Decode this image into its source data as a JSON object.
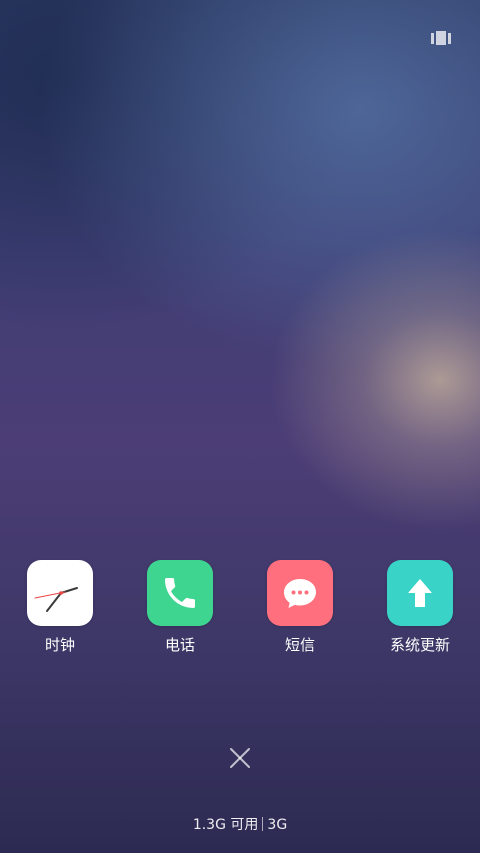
{
  "recents": {
    "icon": "recents-overview-icon"
  },
  "apps": [
    {
      "label": "时钟",
      "icon": "clock-icon",
      "color": "#ffffff"
    },
    {
      "label": "电话",
      "icon": "phone-icon",
      "color": "#3dd58f"
    },
    {
      "label": "短信",
      "icon": "message-icon",
      "color": "#ff6f7d"
    },
    {
      "label": "系统更新",
      "icon": "update-arrow-icon",
      "color": "#3ad3c8"
    }
  ],
  "close_all": {
    "icon": "close-icon"
  },
  "memory": {
    "available": "1.3G 可用",
    "total": "3G"
  }
}
